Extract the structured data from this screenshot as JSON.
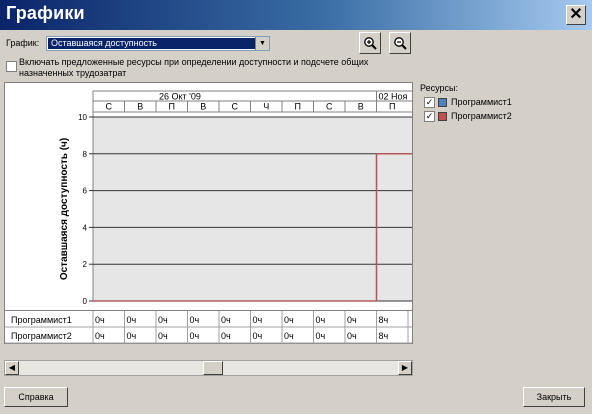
{
  "window": {
    "title": "Графики",
    "close_label": "✕"
  },
  "graph_select": {
    "label": "График:",
    "value": "Оставшаяся доступность"
  },
  "include_option": {
    "checked": false,
    "label_line1": "Включать предложенные ресурсы при определении доступности и подсчете общих",
    "label_line2": "назначенных трудозатрат"
  },
  "zoom": {
    "in_icon": "zoom-in-icon",
    "out_icon": "zoom-out-icon"
  },
  "timescale": {
    "major": [
      "26 Окт '09",
      "02 Ноя"
    ],
    "minor": [
      "С",
      "В",
      "П",
      "В",
      "С",
      "Ч",
      "П",
      "С",
      "В",
      "П"
    ]
  },
  "chart_data": {
    "type": "line",
    "ylabel": "Оставшаяся доступность (ч)",
    "ylim": [
      0,
      10
    ],
    "yticks": [
      "0",
      "2",
      "4",
      "6",
      "8",
      "10"
    ],
    "x": [
      "С",
      "В",
      "П",
      "В",
      "С",
      "Ч",
      "П",
      "С",
      "В",
      "П"
    ],
    "series": [
      {
        "name": "Программист1",
        "color": "#4f81bd",
        "values": [
          0,
          0,
          0,
          0,
          0,
          0,
          0,
          0,
          0,
          8
        ]
      },
      {
        "name": "Программист2",
        "color": "#c0504d",
        "values": [
          0,
          0,
          0,
          0,
          0,
          0,
          0,
          0,
          0,
          8
        ]
      }
    ],
    "grid": true
  },
  "resources": {
    "label": "Ресурсы:",
    "items": [
      {
        "name": "Программист1",
        "color": "#4f81bd",
        "checked": true
      },
      {
        "name": "Программист2",
        "color": "#c0504d",
        "checked": true
      }
    ]
  },
  "table": {
    "rows": [
      {
        "name": "Программист1",
        "values": [
          "0ч",
          "0ч",
          "0ч",
          "0ч",
          "0ч",
          "0ч",
          "0ч",
          "0ч",
          "0ч",
          "8ч"
        ]
      },
      {
        "name": "Программист2",
        "values": [
          "0ч",
          "0ч",
          "0ч",
          "0ч",
          "0ч",
          "0ч",
          "0ч",
          "0ч",
          "0ч",
          "8ч"
        ]
      }
    ]
  },
  "buttons": {
    "help": "Справка",
    "close": "Закрыть"
  }
}
